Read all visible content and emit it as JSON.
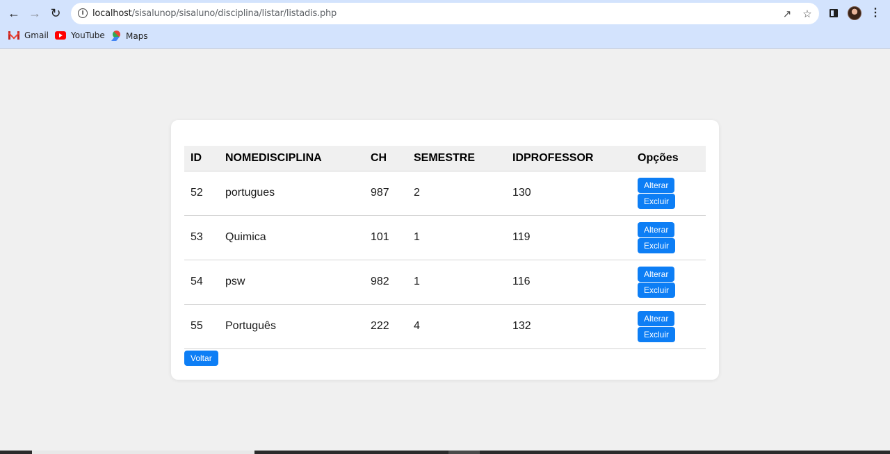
{
  "browser": {
    "url_host": "localhost",
    "url_path": "/sisalunop/sisaluno/disciplina/listar/listadis.php",
    "bookmarks": [
      {
        "label": "Gmail",
        "icon": "gmail-icon"
      },
      {
        "label": "YouTube",
        "icon": "youtube-icon"
      },
      {
        "label": "Maps",
        "icon": "maps-icon"
      }
    ]
  },
  "table": {
    "headers": [
      "ID",
      "NOMEDISCIPLINA",
      "CH",
      "SEMESTRE",
      "IDPROFESSOR",
      "Opções"
    ],
    "rows": [
      {
        "id": "52",
        "nome": "portugues",
        "ch": "987",
        "semestre": "2",
        "idprofessor": "130"
      },
      {
        "id": "53",
        "nome": "Quimica",
        "ch": "101",
        "semestre": "1",
        "idprofessor": "119"
      },
      {
        "id": "54",
        "nome": "psw",
        "ch": "982",
        "semestre": "1",
        "idprofessor": "116"
      },
      {
        "id": "55",
        "nome": "Português",
        "ch": "222",
        "semestre": "4",
        "idprofessor": "132"
      }
    ],
    "alterar_label": "Alterar",
    "excluir_label": "Excluir"
  },
  "voltar_label": "Voltar",
  "colors": {
    "button": "#0d7ef5",
    "chrome": "#d3e3fd",
    "page_bg": "#f0f0f0"
  }
}
